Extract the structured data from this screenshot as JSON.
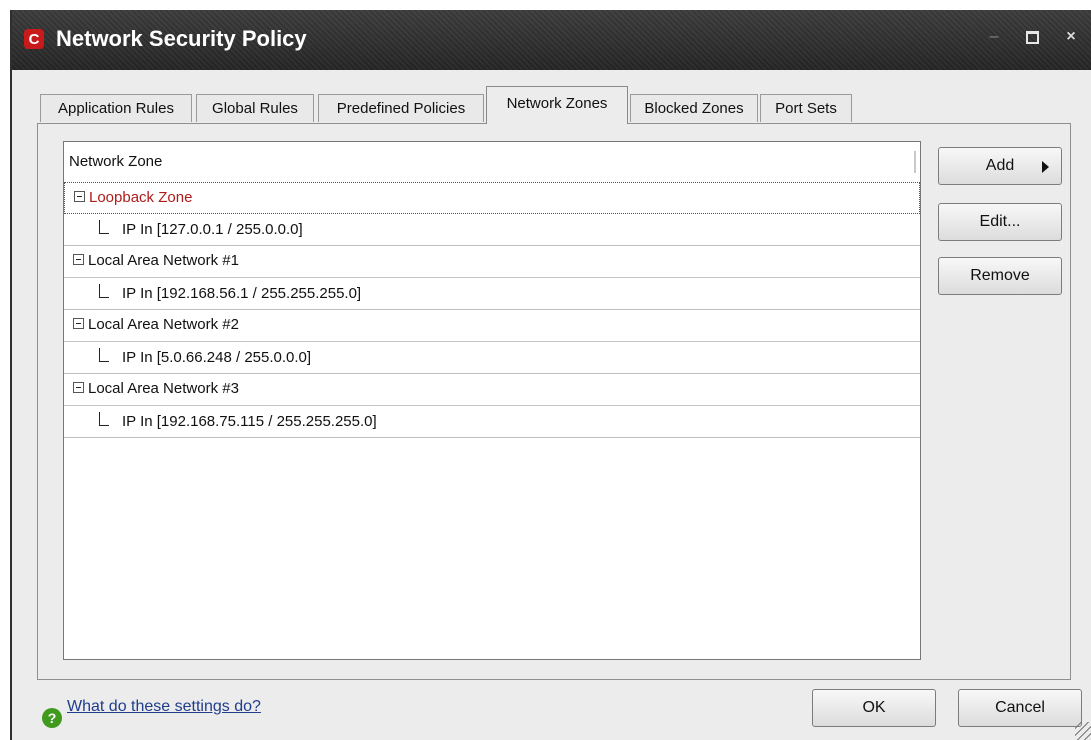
{
  "window": {
    "title": "Network Security Policy",
    "logo_letter": "C",
    "controls": {
      "minimize": "–",
      "maximize": "",
      "close": "×"
    }
  },
  "tabs": [
    {
      "label": "Application Rules",
      "active": false
    },
    {
      "label": "Global Rules",
      "active": false
    },
    {
      "label": "Predefined Policies",
      "active": false
    },
    {
      "label": "Network Zones",
      "active": true
    },
    {
      "label": "Blocked Zones",
      "active": false
    },
    {
      "label": "Port Sets",
      "active": false
    }
  ],
  "list": {
    "header": "Network Zone",
    "zones": [
      {
        "name": "Loopback Zone",
        "entry": "IP In [127.0.0.1 / 255.0.0.0]",
        "selected": true
      },
      {
        "name": "Local Area Network #1",
        "entry": "IP In [192.168.56.1 / 255.255.255.0]",
        "selected": false
      },
      {
        "name": "Local Area Network #2",
        "entry": "IP In [5.0.66.248 / 255.0.0.0]",
        "selected": false
      },
      {
        "name": "Local Area Network #3",
        "entry": "IP In [192.168.75.115 / 255.255.255.0]",
        "selected": false
      }
    ]
  },
  "side_buttons": {
    "add": "Add",
    "edit": "Edit...",
    "remove": "Remove"
  },
  "footer": {
    "help_icon": "?",
    "help_link": "What do these settings do?",
    "ok": "OK",
    "cancel": "Cancel"
  },
  "colors": {
    "selected_zone_text": "#b01c1c",
    "help_link": "#1f3d8c",
    "titlebar": "#2e2e2e"
  }
}
